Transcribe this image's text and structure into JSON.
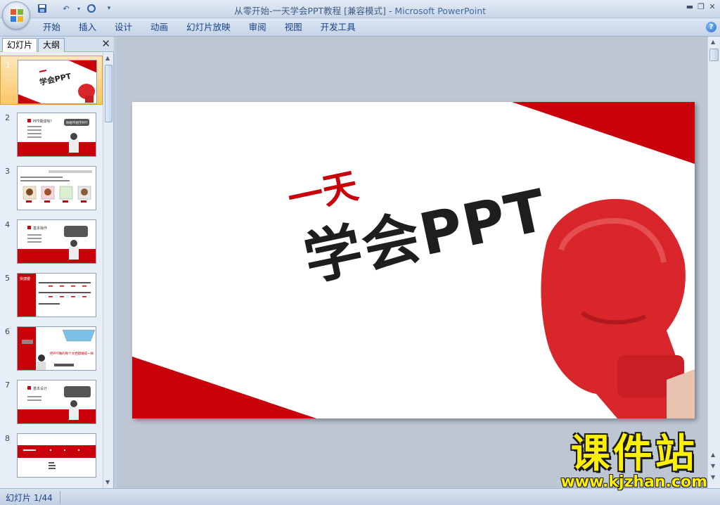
{
  "app": {
    "title_doc": "从零开始-一天学会PPT教程 [兼容模式]",
    "title_sep": " - ",
    "title_app": "Microsoft PowerPoint"
  },
  "menu": {
    "items": [
      "开始",
      "插入",
      "设计",
      "动画",
      "幻灯片放映",
      "审阅",
      "视图",
      "开发工具"
    ]
  },
  "leftpane": {
    "tab_slides": "幻灯片",
    "tab_outline": "大纲",
    "close_glyph": "✕",
    "slide_numbers": [
      "1",
      "2",
      "3",
      "4",
      "5",
      "6",
      "7",
      "8"
    ]
  },
  "slide": {
    "line1": "一天",
    "line2": "学会PPT"
  },
  "thumbnails": {
    "s2_title": "PPT做成啥？",
    "s2_bubble": "你想不想学PPT",
    "s4_title": "基本操作",
    "s5_title": "快捷键",
    "s6_text": "把PPT做的每个文档都做成一样",
    "s7_title": "基本设计"
  },
  "status": {
    "slide_counter": "幻灯片 1/44"
  },
  "watermark": {
    "main": "课件站",
    "url": "www.kjzhan.com"
  },
  "colors": {
    "accent_red": "#c8000a",
    "ribbon_text": "#15428b",
    "watermark_yellow": "#ffef00"
  }
}
